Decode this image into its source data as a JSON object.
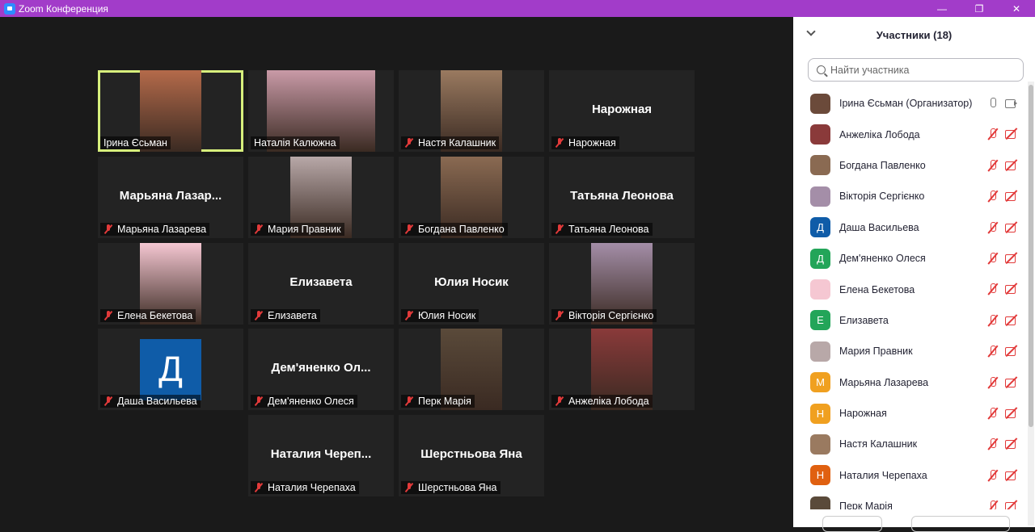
{
  "window": {
    "title": "Zoom Конференция",
    "controls": [
      "—",
      "❐",
      "✕"
    ]
  },
  "tiles": [
    {
      "name": "Ірина Єсьман",
      "active": true,
      "muted": false,
      "video": true,
      "color": "#b46a4a"
    },
    {
      "name": "Наталія Калюжна",
      "muted": false,
      "video": true,
      "color": "#c99aa7"
    },
    {
      "name": "Настя Калашник",
      "muted": true,
      "video": true,
      "color": "#9a7a60"
    },
    {
      "name": "Нарожная",
      "big": "Нарожная",
      "muted": true,
      "video": false
    },
    {
      "name": "Марьяна Лазарева",
      "big": "Марьяна Лазар...",
      "muted": true,
      "video": false
    },
    {
      "name": "Мария Правник",
      "muted": true,
      "video": true,
      "color": "#b8a8a8"
    },
    {
      "name": "Богдана Павленко",
      "muted": true,
      "video": true,
      "color": "#8a6a52"
    },
    {
      "name": "Татьяна Леонова",
      "big": "Татьяна Леонова",
      "muted": true,
      "video": false
    },
    {
      "name": "Елена Бекетова",
      "muted": true,
      "video": true,
      "color": "#f5c7d2"
    },
    {
      "name": "Елизавета",
      "big": "Елизавета",
      "muted": true,
      "video": false
    },
    {
      "name": "Юлия Носик",
      "big": "Юлия Носик",
      "muted": true,
      "video": false
    },
    {
      "name": "Вікторія Сергієнко",
      "muted": true,
      "video": true,
      "color": "#a48ea8"
    },
    {
      "name": "Даша Васильева",
      "muted": true,
      "video": false,
      "avatar": "Д"
    },
    {
      "name": "Дем'яненко Олеся",
      "big": "Дем'яненко  Ол...",
      "muted": true,
      "video": false
    },
    {
      "name": "Перк Марія",
      "muted": true,
      "video": true,
      "color": "#5a4a3a"
    },
    {
      "name": "Анжеліка Лобода",
      "muted": true,
      "video": true,
      "color": "#8a3a3a"
    },
    {
      "name": "Наталия Черепаха",
      "big": "Наталия  Череп...",
      "muted": true,
      "video": false
    },
    {
      "name": "Шерстньова Яна",
      "big": "Шерстньова Яна",
      "muted": true,
      "video": false
    }
  ],
  "panel": {
    "title": "Участники (18)",
    "search_placeholder": "Найти участника",
    "participants": [
      {
        "name": "Ірина Єсьман (Организатор)",
        "avatar_color": "#6b4a3a",
        "host": true
      },
      {
        "name": "Анжеліка Лобода",
        "avatar_color": "#8a3a3a"
      },
      {
        "name": "Богдана Павленко",
        "avatar_color": "#8a6a52"
      },
      {
        "name": "Вікторія Сергієнко",
        "avatar_color": "#a48ea8"
      },
      {
        "name": "Даша Васильева",
        "avatar_color": "#0f5ca8",
        "letter": "Д"
      },
      {
        "name": "Дем'яненко Олеся",
        "avatar_color": "#23a559",
        "letter": "Д"
      },
      {
        "name": "Елена Бекетова",
        "avatar_color": "#f5c7d2"
      },
      {
        "name": "Елизавета",
        "avatar_color": "#23a559",
        "letter": "Е"
      },
      {
        "name": "Мария Правник",
        "avatar_color": "#b8a8a8"
      },
      {
        "name": "Марьяна Лазарева",
        "avatar_color": "#f0a020",
        "letter": "М"
      },
      {
        "name": "Нарожная",
        "avatar_color": "#f0a020",
        "letter": "Н"
      },
      {
        "name": "Настя Калашник",
        "avatar_color": "#9a7a60"
      },
      {
        "name": "Наталия Черепаха",
        "avatar_color": "#e06010",
        "letter": "Н"
      },
      {
        "name": "Перк Марія",
        "avatar_color": "#5a4a3a"
      }
    ]
  }
}
